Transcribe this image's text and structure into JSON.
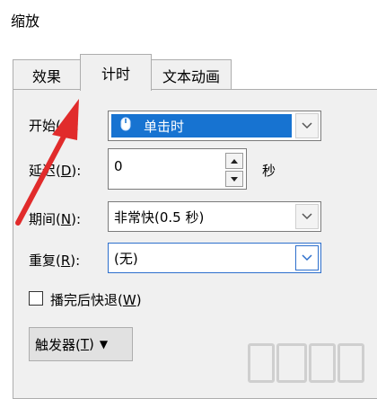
{
  "window": {
    "title": "缩放"
  },
  "tabs": [
    {
      "label": "效果"
    },
    {
      "label": "计时"
    },
    {
      "label": "文本动画"
    }
  ],
  "form": {
    "start": {
      "label": "开始(",
      "label_hidden": "S",
      "label_end": "):",
      "value": "单击时"
    },
    "delay": {
      "label": "延迟(",
      "key": "D",
      "label_end": "):",
      "value": "0",
      "unit": "秒"
    },
    "duration": {
      "label": "期间(",
      "key": "N",
      "label_end": "):",
      "value": "非常快(0.5 秒)"
    },
    "repeat": {
      "label": "重复(",
      "key": "R",
      "label_end": "):",
      "value": "(无)"
    },
    "rewind": {
      "label": "播完后快退(",
      "key": "W",
      "label_end": ")",
      "checked": false
    },
    "trigger": {
      "label": "触发器(",
      "key": "T",
      "label_end": ")",
      "arrow": "▼"
    }
  },
  "colors": {
    "accent": "#1773d1",
    "annotation": "#e12b2b"
  },
  "icons": {
    "start_icon": "mouse-icon"
  }
}
